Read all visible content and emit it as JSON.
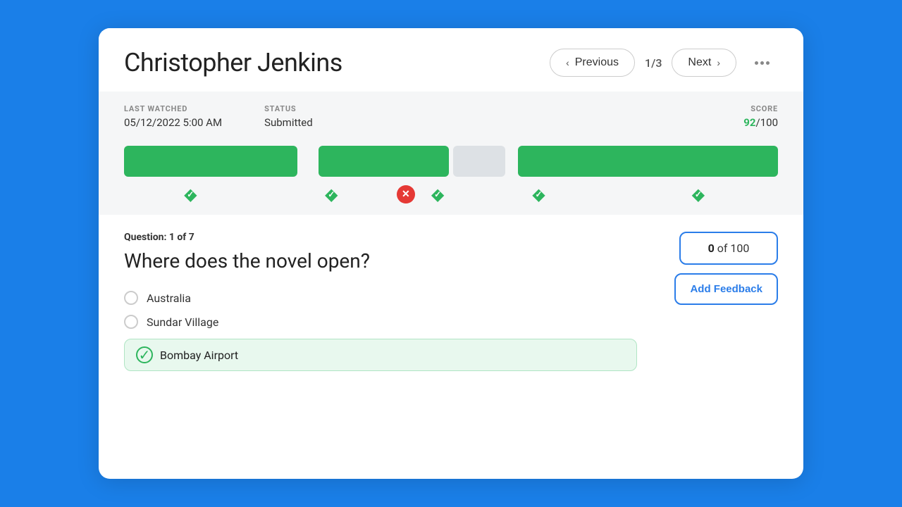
{
  "header": {
    "title": "Christopher Jenkins",
    "prev_label": "Previous",
    "next_label": "Next",
    "page_indicator": "1/3",
    "more_dots": "..."
  },
  "info_bar": {
    "last_watched_label": "LAST WATCHED",
    "last_watched_value": "05/12/2022  5:00 AM",
    "status_label": "STATUS",
    "status_value": "Submitted",
    "score_label": "SCORE",
    "score_num": "92",
    "score_total": "100"
  },
  "question": {
    "meta_prefix": "Question: ",
    "meta_current": "1 of 7",
    "text": "Where does the novel open?",
    "score_display": "0 of 100",
    "score_value": "0",
    "score_max": "100",
    "add_feedback_label": "Add Feedback",
    "options": [
      {
        "text": "Australia",
        "correct": false
      },
      {
        "text": "Sundar Village",
        "correct": false
      },
      {
        "text": "Bombay Airport",
        "correct": true
      }
    ]
  },
  "progress": {
    "segments": [
      {
        "type": "green",
        "flex": 2
      },
      {
        "type": "gap",
        "flex": 0.15
      },
      {
        "type": "green",
        "flex": 1.5
      },
      {
        "type": "gray",
        "flex": 0.6
      },
      {
        "type": "gap",
        "flex": 0.05
      },
      {
        "type": "green",
        "flex": 3
      }
    ],
    "icons": [
      {
        "type": "check",
        "pos": 1
      },
      {
        "type": "check",
        "pos": 2
      },
      {
        "type": "cross",
        "pos": 3
      },
      {
        "type": "check",
        "pos": 4
      },
      {
        "type": "check",
        "pos": 5
      },
      {
        "type": "check",
        "pos": 6
      }
    ]
  }
}
